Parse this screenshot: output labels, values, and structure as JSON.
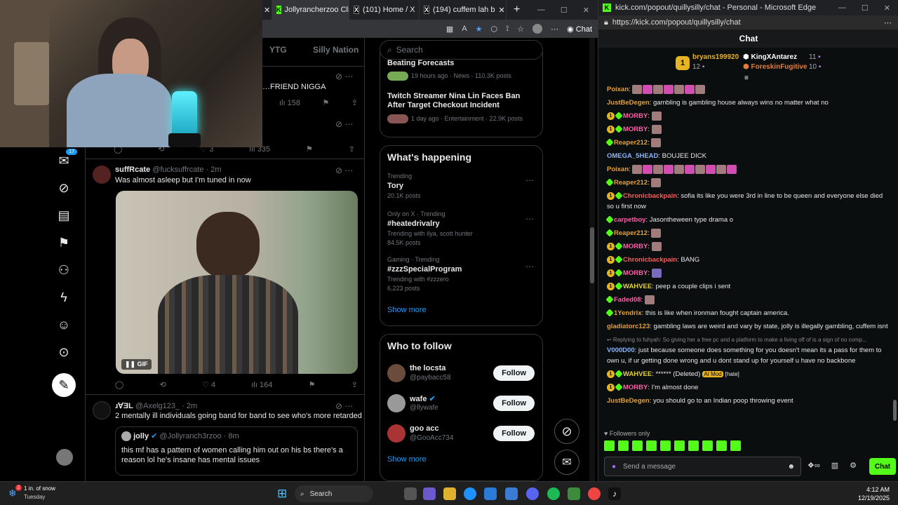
{
  "browser_left": {
    "tabs": [
      {
        "label": "Jollyrancherzoo Cli",
        "icon": "kick-favicon"
      },
      {
        "label": "(101) Home / X",
        "icon": "x-favicon"
      },
      {
        "label": "(194) cuffem lah b",
        "icon": "x-favicon"
      }
    ]
  },
  "x": {
    "topnav": [
      "YTG",
      "Silly Nation"
    ],
    "notif_count": "17",
    "search_placeholder": "Search",
    "partial_post": {
      "text": "…FRIEND NIGGA",
      "views": "158"
    },
    "partial_stats": {
      "likes": "3",
      "views": "335"
    },
    "posts": [
      {
        "name": "suffRcate",
        "handle": "@fucksuffrcate · 2m",
        "text": "Was almost asleep but I'm tuned in now",
        "gif_label": "GIF",
        "likes": "4",
        "views": "164"
      },
      {
        "name": "ɹ∀ƎL",
        "handle": "@Axelg123_ · 2m",
        "text": "2 mentally ill individuals going band for band to see who's more retarded",
        "quote": {
          "name": "jolly",
          "handle": "@Jollyranch3rzoo · 8m",
          "text": "this mf has a pattern of women calling him out on his bs there's a reason lol he's insane has mental issues"
        }
      }
    ],
    "news": [
      {
        "title": "Beating Forecasts",
        "meta": "19 hours ago · News · 110.3K posts"
      },
      {
        "title": "Twitch Streamer Nina Lin Faces Ban After Target Checkout Incident",
        "meta": "1 day ago · Entertainment · 22.9K posts"
      }
    ],
    "happening": {
      "title": "What's happening",
      "items": [
        {
          "context": "Trending",
          "topic": "Tory",
          "with": "",
          "posts": "20.1K posts"
        },
        {
          "context": "Only on X · Trending",
          "topic": "#heatedrivalry",
          "with": "Trending with ilya, scott hunter",
          "posts": "84.5K posts"
        },
        {
          "context": "Gaming · Trending",
          "topic": "#zzzSpecialProgram",
          "with": "Trending with #zzzero",
          "posts": "6,223 posts"
        }
      ],
      "show_more": "Show more"
    },
    "who_to_follow": {
      "title": "Who to follow",
      "accounts": [
        {
          "name": "the locsta",
          "handle": "@paybacc58"
        },
        {
          "name": "wafe",
          "handle": "@llywafe"
        },
        {
          "name": "goo acc",
          "handle": "@GooAcc734"
        }
      ],
      "follow_label": "Follow",
      "show_more": "Show more"
    }
  },
  "chat_window": {
    "title": "kick.com/popout/quillysilly/chat - Personal - Microsoft Edge",
    "url": "https://kick.com/popout/quillysilly/chat",
    "header": "Chat",
    "leaders": [
      {
        "name": "bryans199920",
        "count": "12"
      },
      {
        "name": "KingXAntarez",
        "count": "11"
      },
      {
        "name": "ForeskinFugitive",
        "count": "10"
      }
    ],
    "messages": [
      {
        "user": "Poixan",
        "color": "#e3a13a",
        "text": "",
        "emotes": 7
      },
      {
        "user": "JustBeDegen",
        "color": "#e3a13a",
        "text": "gambling is gambling house always wins no matter what no",
        "emotes": 0
      },
      {
        "user": "MORBY",
        "color": "#ff5ea8",
        "text": "",
        "emotes": 1
      },
      {
        "user": "MORBY",
        "color": "#ff5ea8",
        "text": "",
        "emotes": 1
      },
      {
        "user": "Reaper212",
        "color": "#e3a13a",
        "text": "",
        "emotes": 1
      },
      {
        "user": "OMEGA_5HEAD",
        "color": "#8ab4f8",
        "text": "BOUJEE DICK",
        "emotes": 0
      },
      {
        "user": "Poixan",
        "color": "#e3a13a",
        "text": "",
        "emotes": 10
      },
      {
        "user": "Reaper212",
        "color": "#e3a13a",
        "text": "",
        "emotes": 1
      },
      {
        "user": "Chronicbackpain",
        "color": "#ff5a5a",
        "text": "sofia its like you were 3rd in line to be queen and everyone else died so u first now",
        "emotes": 0
      },
      {
        "user": "carpetboy",
        "color": "#ff5ea8",
        "text": "Jasontheween type drama o",
        "emotes": 0
      },
      {
        "user": "Reaper212",
        "color": "#e3a13a",
        "text": "",
        "emotes": 1
      },
      {
        "user": "MORBY",
        "color": "#ff5ea8",
        "text": "",
        "emotes": 1
      },
      {
        "user": "Chronicbackpain",
        "color": "#ff5a5a",
        "text": "BANG",
        "emotes": 0
      },
      {
        "user": "MORBY",
        "color": "#ff5ea8",
        "text": "",
        "emotes": 1
      },
      {
        "user": "WAHVEE",
        "color": "#e6d23a",
        "text": "peep a couple clips i sent",
        "emotes": 0
      },
      {
        "user": "Faded08",
        "color": "#ff5ea8",
        "text": "",
        "emotes": 1
      },
      {
        "user": "1Yendrix",
        "color": "#e3a13a",
        "text": "this is like when ironman fought captain america.",
        "emotes": 0
      },
      {
        "user": "gladiatorc123",
        "color": "#e3a13a",
        "text": "gambling laws are weird and vary by state, jolly is illegally gambling, cuffem isnt",
        "emotes": 0
      },
      {
        "user": "V000D00",
        "color": "#8ab4f8",
        "text": "just because someone does something for you doesn't mean its a pass for them to own u, if ur getting done wrong and u dont stand up for yourself u have no backbone",
        "reply": "Replying to fuhyah: So giving her a free pc and a platform to make a living off of is a sign of no comp...",
        "emotes": 0
      },
      {
        "user": "WAHVEE",
        "color": "#e6d23a",
        "text": "****** (Deleted)",
        "tag": "AI Mod",
        "tag2": "[hate]",
        "emotes": 0
      },
      {
        "user": "MORBY",
        "color": "#ff5ea8",
        "text": "I'm almost done",
        "emotes": 0
      },
      {
        "user": "JustBeDegen",
        "color": "#e3a13a",
        "text": "you should go to an Indian poop throwing event",
        "emotes": 0
      }
    ],
    "followers_only": "Followers only",
    "input_placeholder": "Send a message",
    "send_label": "Chat"
  },
  "taskbar": {
    "weather": "1 in. of snow",
    "weather_day": "Tuesday",
    "badge": "2",
    "search_label": "Search",
    "time": "4:12 AM",
    "date": "12/19/2025"
  }
}
